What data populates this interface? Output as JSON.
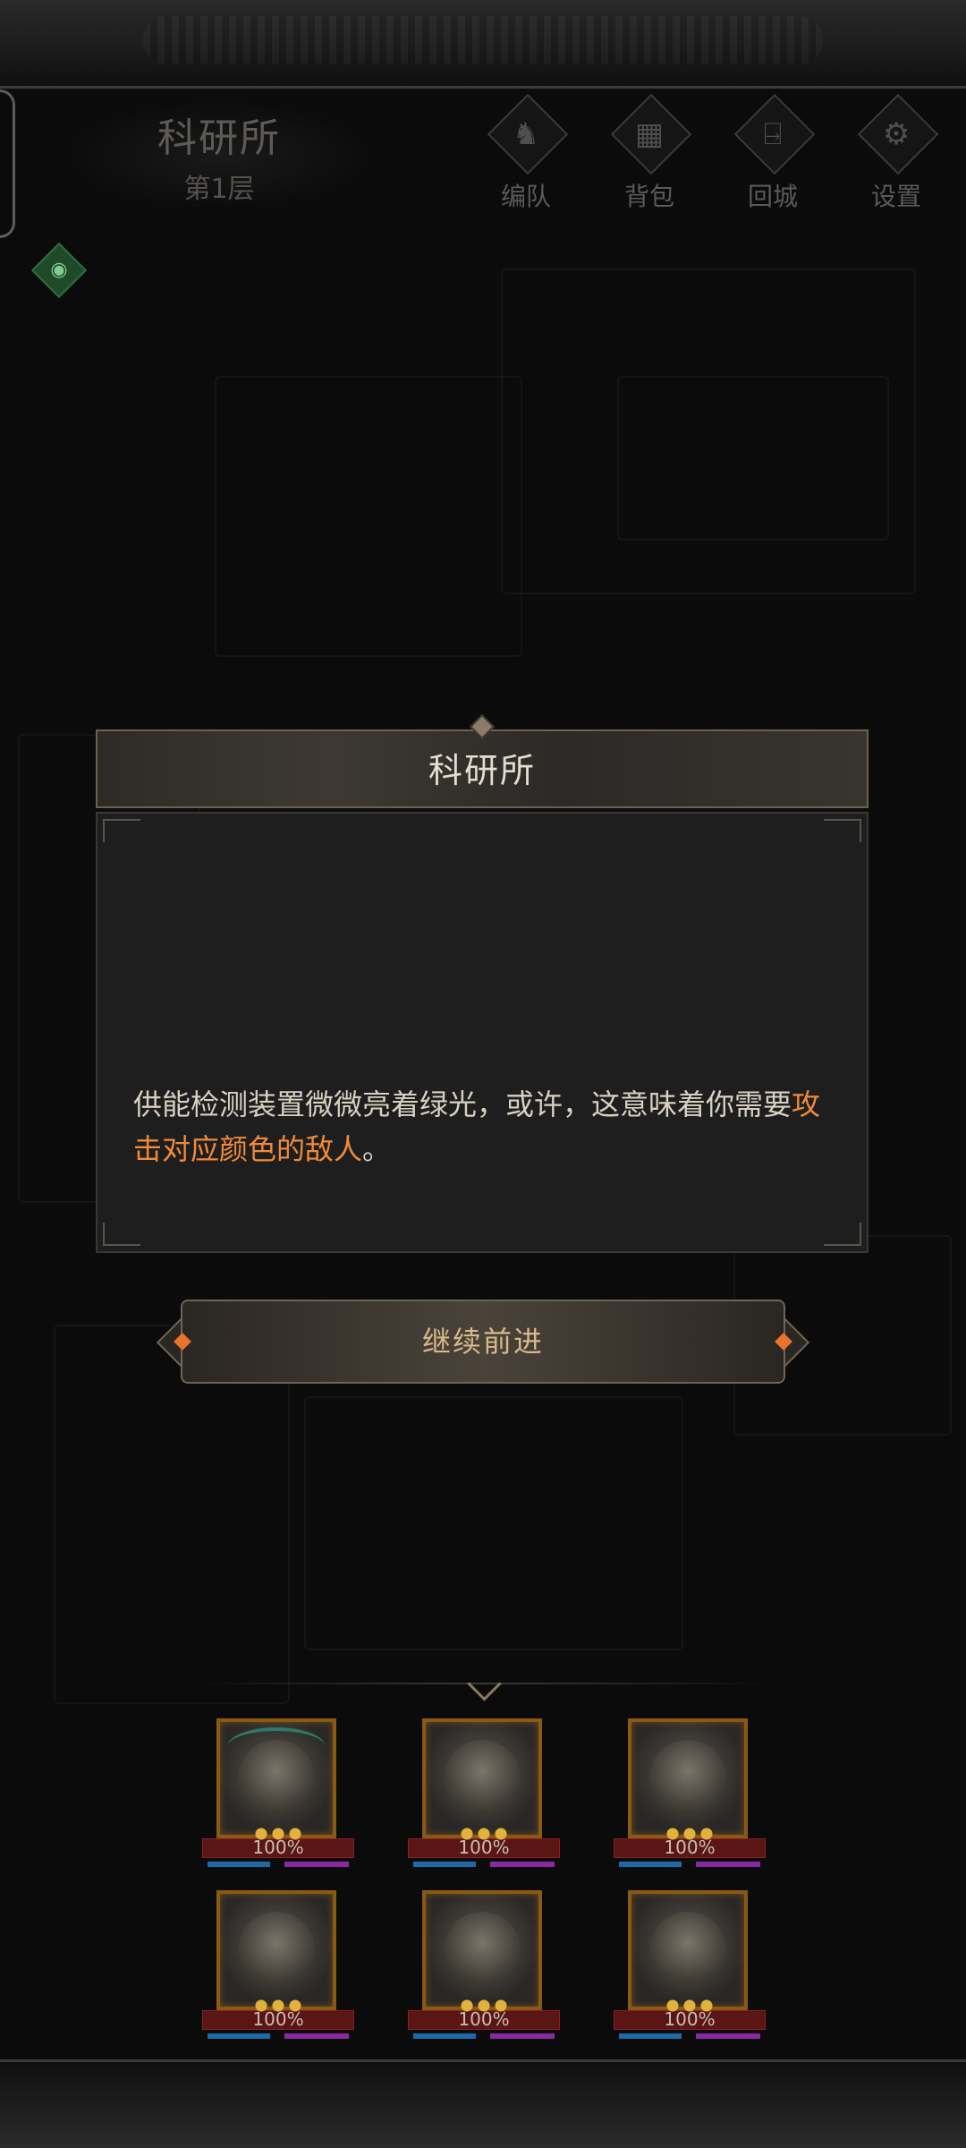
{
  "location": {
    "title": "科研所",
    "floor": "第1层"
  },
  "menu": [
    {
      "label": "编队",
      "icon": "helmet-icon"
    },
    {
      "label": "背包",
      "icon": "backpack-icon"
    },
    {
      "label": "回城",
      "icon": "door-exit-icon"
    },
    {
      "label": "设置",
      "icon": "gear-icon"
    }
  ],
  "dialog": {
    "title": "科研所",
    "text_main": "供能检测装置微微亮着绿光，或许，这意味着你需要",
    "text_highlight": "攻击对应颜色的敌人",
    "text_end": "。"
  },
  "continue_button": {
    "label": "继续前进"
  },
  "team": {
    "heroes": [
      {
        "hp": "100%",
        "portrait": "antler-elf-portrait"
      },
      {
        "hp": "100%",
        "portrait": "silver-hair-woman-portrait"
      },
      {
        "hp": "100%",
        "portrait": "dragon-armor-portrait"
      },
      {
        "hp": "100%",
        "portrait": "blonde-warrior-portrait"
      },
      {
        "hp": "100%",
        "portrait": "brown-hair-woman-portrait"
      },
      {
        "hp": "100%",
        "portrait": "werewolf-portrait"
      }
    ]
  },
  "colors": {
    "accent_orange": "#f28a3a",
    "hp_red": "#5a1515",
    "frame_gold": "#8b5a12"
  }
}
